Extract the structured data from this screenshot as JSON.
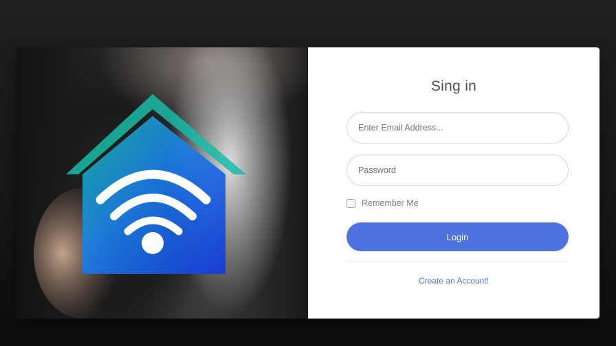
{
  "hero": {
    "image_description_icon": "smart-home-wifi-icon",
    "colors": {
      "house_blue": "#1b4fe0",
      "house_teal": "#18c3b0"
    }
  },
  "form": {
    "title": "Sing in",
    "email": {
      "placeholder": "Enter Email Address...",
      "value": ""
    },
    "password": {
      "placeholder": "Password",
      "value": ""
    },
    "remember_label": "Remember Me",
    "remember_checked": false,
    "login_label": "Login",
    "create_account_label": "Create an Account!"
  },
  "colors": {
    "accent": "#4e73df",
    "text": "#4b4f56",
    "background": "#1b1b1b"
  }
}
